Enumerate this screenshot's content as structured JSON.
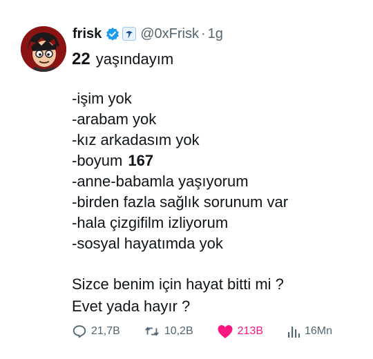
{
  "author": {
    "name": "frisk",
    "handle": "@0xFrisk",
    "time": "1g"
  },
  "tweet": {
    "age": "22",
    "intro": "yaşındayım",
    "lines": [
      "-işim yok",
      "-arabam yok",
      "-kız arkadasım yok"
    ],
    "height_prefix": "-boyum",
    "height_value": "167",
    "more_lines": [
      "-anne-babamla yaşıyorum",
      "-birden fazla sağlık sorunum var",
      "-hala çizgifilm izliyorum",
      "-sosyal hayatımda yok"
    ],
    "question": [
      "Sizce benim için hayat bitti mi ?",
      "Evet yada hayır ?"
    ]
  },
  "stats": {
    "replies": "21,7B",
    "retweets": "10,2B",
    "likes": "213B",
    "views": "16Mn"
  },
  "colors": {
    "text": "#0f1419",
    "muted": "#536471",
    "verified": "#1d9bf0",
    "like": "#f91880"
  },
  "icons": {
    "verified": "verified-badge-icon",
    "affiliate": "affiliate-badge-icon",
    "reply": "reply-icon",
    "retweet": "retweet-icon",
    "like": "heart-icon",
    "views": "views-icon"
  }
}
